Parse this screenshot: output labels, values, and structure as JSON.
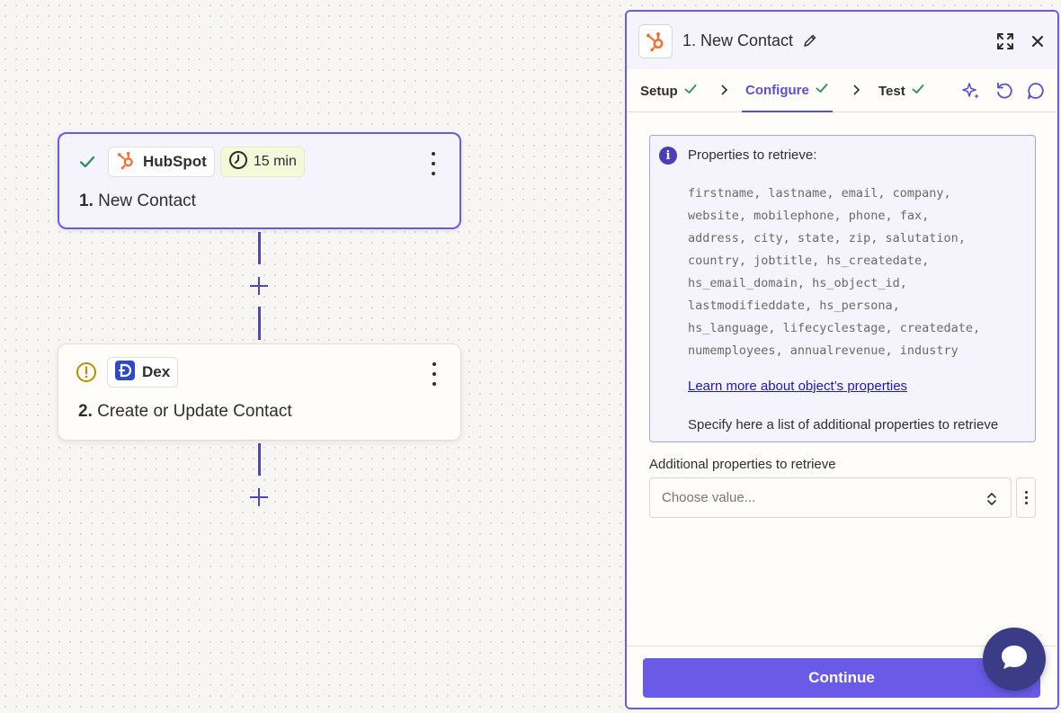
{
  "canvas": {
    "steps": [
      {
        "status": "check-icon",
        "app_name": "HubSpot",
        "app_icon": "hubspot-logo-icon",
        "badge": "15 min",
        "number": "1.",
        "title": "New Contact",
        "selected": true
      },
      {
        "status": "warning-icon",
        "app_name": "Dex",
        "app_icon": "dex-logo-icon",
        "number": "2.",
        "title": "Create or Update Contact",
        "selected": false
      }
    ]
  },
  "panel": {
    "title": "1. New Contact",
    "tabs": [
      {
        "label": "Setup",
        "complete": true
      },
      {
        "label": "Configure",
        "complete": true,
        "active": true
      },
      {
        "label": "Test",
        "complete": true
      }
    ],
    "info_title": "Properties to retrieve:",
    "property_lines": [
      "firstname, lastname, email, company,",
      "website, mobilephone, phone, fax,",
      "address, city, state, zip, salutation,",
      "country, jobtitle, hs_createdate,",
      "hs_email_domain, hs_object_id,",
      "lastmodifieddate, hs_persona,",
      "hs_language, lifecyclestage, createdate,",
      "numemployees, annualrevenue, industry"
    ],
    "learn_link": "Learn more about object’s properties",
    "specify_text": "Specify here a list of additional properties to retrieve",
    "field_label": "Additional properties to retrieve",
    "field_placeholder": "Choose value...",
    "continue_label": "Continue"
  },
  "colors": {
    "accent": "#695be8",
    "success": "#2e8b57",
    "warning": "#b58f00",
    "hubspot": "#f0743a",
    "dex": "#2e49c9"
  }
}
